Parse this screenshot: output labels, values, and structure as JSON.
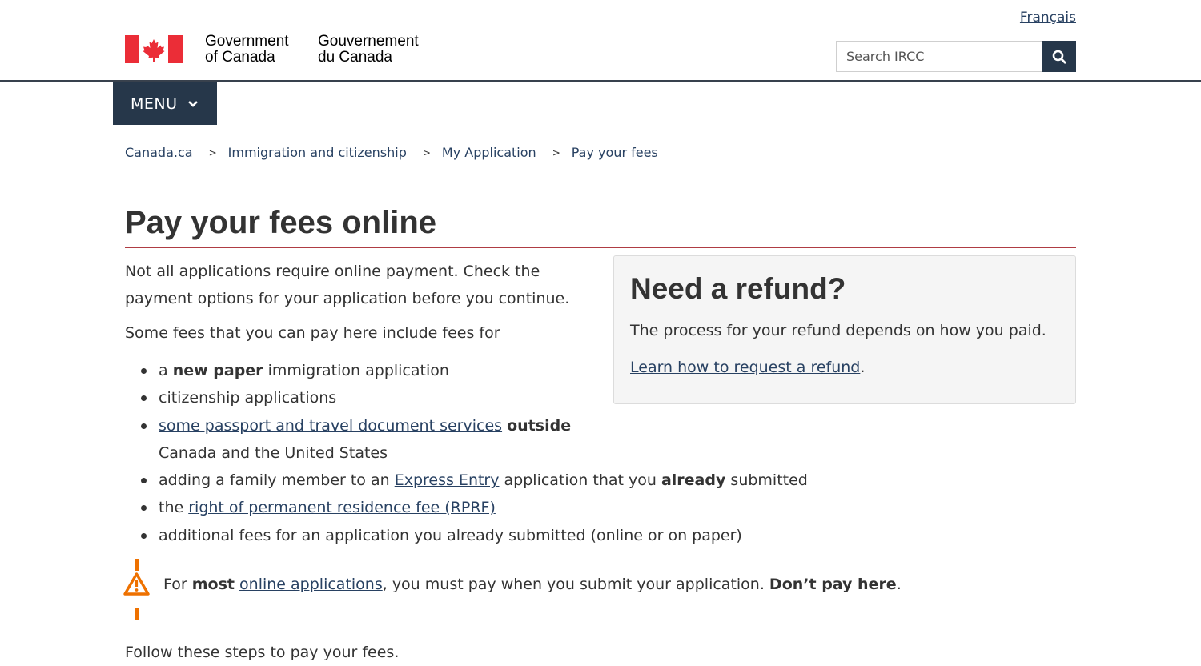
{
  "header": {
    "language_link": "Français",
    "signature_en_line1": "Government",
    "signature_en_line2": "of Canada",
    "signature_fr_line1": "Gouvernement",
    "signature_fr_line2": "du Canada",
    "search_placeholder": "Search IRCC",
    "search_icon": "magnifier-icon",
    "menu_label": "MENU",
    "menu_icon": "chevron-down-icon",
    "brand_color": "#26374a",
    "flag_color": "#eb2d37"
  },
  "breadcrumb": {
    "separator": ">",
    "items": [
      {
        "label": "Canada.ca"
      },
      {
        "label": "Immigration and citizenship"
      },
      {
        "label": "My Application"
      },
      {
        "label": "Pay your fees"
      }
    ]
  },
  "main": {
    "title": "Pay your fees online",
    "intro": "Not all applications require online payment. Check the payment options for your application before you continue.",
    "some_fees": "Some fees that you can pay here include fees for",
    "list": {
      "item1": {
        "pre": "a ",
        "bold": "new paper",
        "post": " immigration application"
      },
      "item2": {
        "text": "citizenship applications"
      },
      "item3": {
        "link": "some passport and travel document services",
        "bold": "outside",
        "post": "Canada and the United States"
      },
      "item4": {
        "pre": "adding a family member to an ",
        "link": "Express Entry",
        "mid": " application that you ",
        "bold": "already",
        "post": " submitted"
      },
      "item5": {
        "pre": "the ",
        "link": "right of permanent residence fee (RPRF)"
      },
      "item6": {
        "text": "additional fees for an application you already submitted (online or on paper)"
      }
    },
    "warning": {
      "icon": "warning-icon",
      "pre": "For ",
      "bold1": "most",
      "link": "online applications",
      "mid": ", you must pay when you submit your application. ",
      "bold2": "Don’t pay here",
      "post": ".",
      "color": "#ee7100"
    },
    "follow": "Follow these steps to pay your fees."
  },
  "refund": {
    "title": "Need a refund?",
    "body": "The process for your refund depends on how you paid.",
    "link": "Learn how to request a refund",
    "link_suffix": "."
  }
}
